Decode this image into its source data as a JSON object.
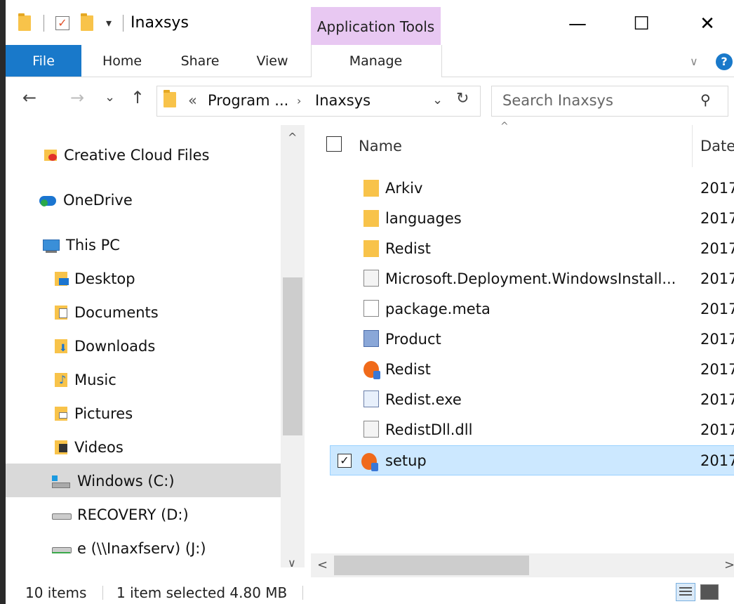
{
  "window": {
    "title": "Inaxsys",
    "context_group": "Application Tools",
    "controls": {
      "minimize": "—",
      "maximize": "☐",
      "close": "✕"
    }
  },
  "ribbon": {
    "tabs": [
      "File",
      "Home",
      "Share",
      "View",
      "Manage"
    ],
    "help": "?"
  },
  "address": {
    "back": "←",
    "forward": "→",
    "recent": "⌄",
    "up": "↑",
    "overflow": "«",
    "crumbs": [
      "Program ...",
      "Inaxsys"
    ],
    "search_placeholder": "Search Inaxsys"
  },
  "nav": {
    "items": [
      {
        "label": "Creative Cloud Files",
        "icon": "creative-cloud-folder-icon"
      },
      {
        "label": "OneDrive",
        "icon": "onedrive-icon"
      },
      {
        "label": "This PC",
        "icon": "computer-icon"
      },
      {
        "label": "Desktop",
        "icon": "desktop-folder-icon"
      },
      {
        "label": "Documents",
        "icon": "documents-folder-icon"
      },
      {
        "label": "Downloads",
        "icon": "downloads-folder-icon"
      },
      {
        "label": "Music",
        "icon": "music-folder-icon"
      },
      {
        "label": "Pictures",
        "icon": "pictures-folder-icon"
      },
      {
        "label": "Videos",
        "icon": "videos-folder-icon"
      },
      {
        "label": "Windows (C:)",
        "icon": "windows-drive-icon"
      },
      {
        "label": "RECOVERY (D:)",
        "icon": "drive-icon"
      },
      {
        "label": "e (\\\\Inaxfserv) (J:)",
        "icon": "network-drive-icon"
      }
    ],
    "selected": "Windows (C:)"
  },
  "list": {
    "columns": {
      "name": "Name",
      "date": "Date"
    },
    "files": [
      {
        "name": "Arkiv",
        "date": "2017",
        "icon": "folder-icon"
      },
      {
        "name": "languages",
        "date": "2017",
        "icon": "folder-icon"
      },
      {
        "name": "Redist",
        "date": "2017",
        "icon": "folder-icon"
      },
      {
        "name": "Microsoft.Deployment.WindowsInstall...",
        "date": "2017",
        "icon": "dll-file-icon"
      },
      {
        "name": "package.meta",
        "date": "2017",
        "icon": "file-icon"
      },
      {
        "name": "Product",
        "date": "2017",
        "icon": "installer-icon"
      },
      {
        "name": "Redist",
        "date": "2017",
        "icon": "setup-app-icon"
      },
      {
        "name": "Redist.exe",
        "date": "2017",
        "icon": "exe-file-icon"
      },
      {
        "name": "RedistDll.dll",
        "date": "2017",
        "icon": "dll-file-icon"
      },
      {
        "name": "setup",
        "date": "2017",
        "icon": "setup-app-icon",
        "selected": true
      }
    ]
  },
  "status": {
    "count": "10 items",
    "selection": "1 item selected  4.80 MB"
  }
}
